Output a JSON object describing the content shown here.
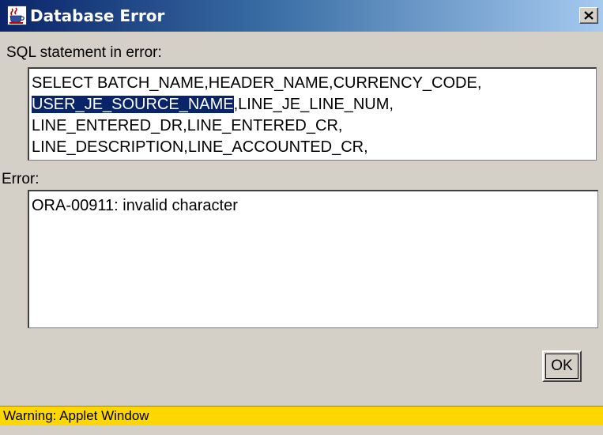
{
  "window": {
    "title": "Database Error",
    "close_glyph": "✕",
    "app_icon": "java-cup-icon"
  },
  "sql_section": {
    "label": "SQL statement in error:",
    "lines": [
      {
        "plain": "SELECT BATCH_NAME,HEADER_NAME,CURRENCY_CODE,",
        "selected": ""
      },
      {
        "selected": "USER_JE_SOURCE_NAME",
        "plain": ",LINE_JE_LINE_NUM,"
      },
      {
        "plain": "LINE_ENTERED_DR,LINE_ENTERED_CR,",
        "selected": ""
      },
      {
        "plain": "LINE_DESCRIPTION,LINE_ACCOUNTED_CR,",
        "selected": ""
      }
    ]
  },
  "error_section": {
    "label": "Error:",
    "message": "ORA-00911: invalid character"
  },
  "buttons": {
    "ok_label": "OK"
  },
  "status": {
    "warning": "Warning: Applet Window",
    "warning_color": "#ffd700"
  },
  "colors": {
    "titlebar_start": "#0a246a",
    "titlebar_end": "#a6caf0",
    "selection": "#0a246a",
    "window_bg": "#d4d0c8"
  }
}
